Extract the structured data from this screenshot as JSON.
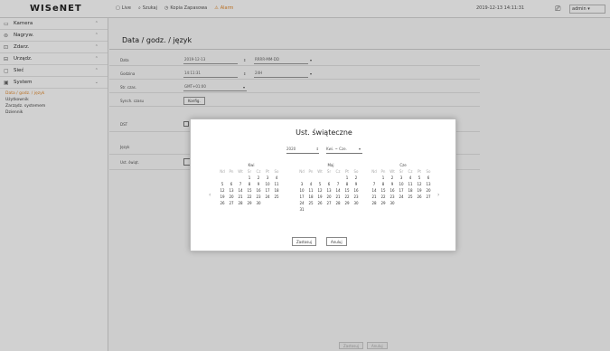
{
  "app": {
    "logo": "WISeNET"
  },
  "topmenu": [
    {
      "icon": "live-icon",
      "glyph": "▢",
      "label": "Live"
    },
    {
      "icon": "search-icon",
      "glyph": "⌕",
      "label": "Szukaj"
    },
    {
      "icon": "backup-icon",
      "glyph": "◷",
      "label": "Kopia Zapasowa"
    },
    {
      "icon": "warning-icon",
      "glyph": "⚠",
      "label": "Alarm"
    }
  ],
  "clock": "2019-12-13 14:11:31",
  "user": {
    "name": "admin"
  },
  "sidebar": {
    "items": [
      {
        "icon": "camera-icon",
        "glyph": "▭",
        "label": "Kamera",
        "chev": "⌃"
      },
      {
        "icon": "record-icon",
        "glyph": "⊜",
        "label": "Nagryw.",
        "chev": "⌃"
      },
      {
        "icon": "event-icon",
        "glyph": "⊡",
        "label": "Zdarz.",
        "chev": "⌃"
      },
      {
        "icon": "device-icon",
        "glyph": "⊟",
        "label": "Urządz.",
        "chev": "⌃"
      },
      {
        "icon": "network-icon",
        "glyph": "▢",
        "label": "Sieć",
        "chev": "⌃"
      },
      {
        "icon": "system-icon",
        "glyph": "▣",
        "label": "System",
        "chev": "⌄"
      }
    ],
    "submenu": [
      "Data / godz. / język",
      "Użytkownik",
      "Zarządz. systemem",
      "Dziennik"
    ]
  },
  "page": {
    "title": "Data / godz. / język",
    "rows": [
      {
        "label": "Data",
        "value": "2019-12-13",
        "value2": "RRRR-MM-DD"
      },
      {
        "label": "Godzina",
        "value": "14:11:31",
        "value2": "24H"
      },
      {
        "label": "Str. czas.",
        "value": "GMT+01:00"
      },
      {
        "label": "Synch. czasu",
        "button": "Konfig."
      },
      {
        "label": "DST"
      },
      {
        "label": "Język"
      },
      {
        "label": "Ust. świąt."
      }
    ],
    "footer": {
      "apply": "Zastosuj",
      "cancel": "Anuluj"
    }
  },
  "modal": {
    "title": "Ust. świąteczne",
    "year": "2020",
    "months_range": "Kwi. ~ Cze.",
    "weekdays": [
      "Nd",
      "Pn",
      "Wt",
      "Śr",
      "Cz",
      "Pt",
      "So"
    ],
    "calendars": [
      {
        "month": "Kwi",
        "days": [
          "",
          "",
          "",
          "1",
          "2",
          "3",
          "4",
          "5",
          "6",
          "7",
          "8",
          "9",
          "10",
          "11",
          "12",
          "13",
          "14",
          "15",
          "16",
          "17",
          "18",
          "19",
          "20",
          "21",
          "22",
          "23",
          "24",
          "25",
          "26",
          "27",
          "28",
          "29",
          "30",
          "",
          ""
        ]
      },
      {
        "month": "Maj",
        "days": [
          "",
          "",
          "",
          "",
          "",
          "1",
          "2",
          "3",
          "4",
          "5",
          "6",
          "7",
          "8",
          "9",
          "10",
          "11",
          "12",
          "13",
          "14",
          "15",
          "16",
          "17",
          "18",
          "19",
          "20",
          "21",
          "22",
          "23",
          "24",
          "25",
          "26",
          "27",
          "28",
          "29",
          "30",
          "31",
          "",
          "",
          "",
          "",
          "",
          ""
        ]
      },
      {
        "month": "Cze",
        "days": [
          "",
          "1",
          "2",
          "3",
          "4",
          "5",
          "6",
          "7",
          "8",
          "9",
          "10",
          "11",
          "12",
          "13",
          "14",
          "15",
          "16",
          "17",
          "18",
          "19",
          "20",
          "21",
          "22",
          "23",
          "24",
          "25",
          "26",
          "27",
          "28",
          "29",
          "30",
          "",
          "",
          "",
          ""
        ]
      }
    ],
    "prev": "‹",
    "next": "›",
    "save": "Zastosuj",
    "cancel": "Anuluj"
  }
}
